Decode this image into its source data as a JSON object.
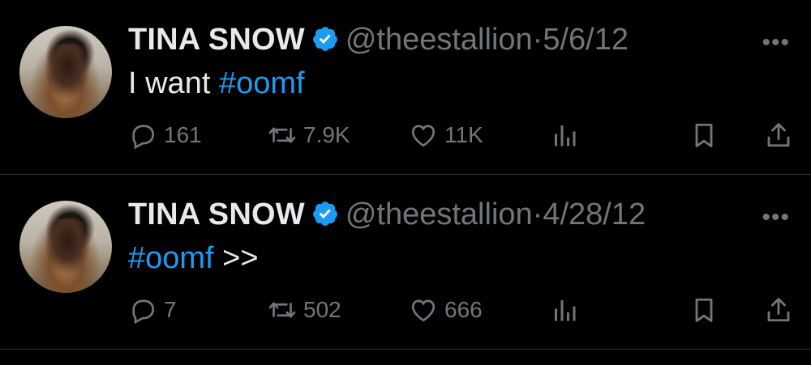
{
  "tweets": [
    {
      "name": "TINA SNOW",
      "handle": "@theestallion",
      "separator": "·",
      "date": "5/6/12",
      "more": "•••",
      "text_plain": "I want ",
      "text_hashtag": "#oomf",
      "text_after": "",
      "replies": "161",
      "retweets": "7.9K",
      "likes": "11K"
    },
    {
      "name": "TINA SNOW",
      "handle": "@theestallion",
      "separator": "·",
      "date": "4/28/12",
      "more": "•••",
      "text_plain": "",
      "text_hashtag": "#oomf",
      "text_after": " >>",
      "replies": "7",
      "retweets": "502",
      "likes": "666"
    }
  ],
  "colors": {
    "background": "#000000",
    "text": "#e7e9ea",
    "muted": "#71767b",
    "accent": "#1d9bf0",
    "divider": "#2f3336"
  },
  "icons": [
    "verified-badge-icon",
    "reply-icon",
    "retweet-icon",
    "like-icon",
    "views-icon",
    "bookmark-icon",
    "share-icon",
    "more-icon"
  ]
}
